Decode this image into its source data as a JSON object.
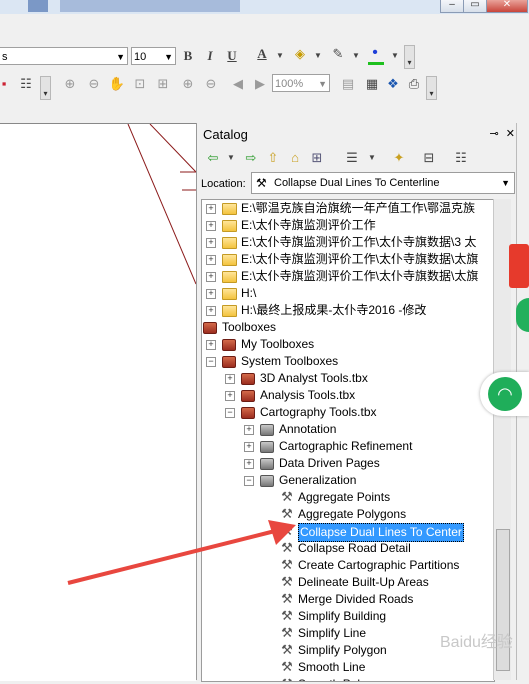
{
  "toolbar1": {
    "font_name_partial": "s",
    "font_size": "10",
    "bold": "B",
    "italic": "I",
    "underline": "U",
    "font_color_letter": "A"
  },
  "toolbar2": {
    "zoom_percent": "100%"
  },
  "catalog": {
    "title": "Catalog",
    "location_label": "Location:",
    "location_value": "Collapse Dual Lines To Centerline",
    "tree": [
      {
        "label": "E:\\鄂温克族自治旗统一年产值工作\\鄂温克族",
        "icon": "folder",
        "indent": 0,
        "expander": "+"
      },
      {
        "label": "E:\\太仆寺旗监测评价工作",
        "icon": "folder",
        "indent": 0,
        "expander": "+"
      },
      {
        "label": "E:\\太仆寺旗监测评价工作\\太仆寺旗数据\\3 太",
        "icon": "folder",
        "indent": 0,
        "expander": "+"
      },
      {
        "label": "E:\\太仆寺旗监测评价工作\\太仆寺旗数据\\太旗",
        "icon": "folder",
        "indent": 0,
        "expander": "+"
      },
      {
        "label": "E:\\太仆寺旗监测评价工作\\太仆寺旗数据\\太旗",
        "icon": "folder",
        "indent": 0,
        "expander": "+"
      },
      {
        "label": "H:\\",
        "icon": "folder",
        "indent": 0,
        "expander": "+"
      },
      {
        "label": "H:\\最终上报成果-太仆寺2016 -修改",
        "icon": "folder",
        "indent": 0,
        "expander": "+"
      },
      {
        "label": "Toolboxes",
        "icon": "toolbox",
        "indent": -1,
        "expander": "−"
      },
      {
        "label": "My Toolboxes",
        "icon": "toolbox",
        "indent": 0,
        "expander": "+"
      },
      {
        "label": "System Toolboxes",
        "icon": "toolbox",
        "indent": 0,
        "expander": "−"
      },
      {
        "label": "3D Analyst Tools.tbx",
        "icon": "toolbox",
        "indent": 1,
        "expander": "+"
      },
      {
        "label": "Analysis Tools.tbx",
        "icon": "toolbox",
        "indent": 1,
        "expander": "+"
      },
      {
        "label": "Cartography Tools.tbx",
        "icon": "toolbox",
        "indent": 1,
        "expander": "−"
      },
      {
        "label": "Annotation",
        "icon": "toolset",
        "indent": 2,
        "expander": "+"
      },
      {
        "label": "Cartographic Refinement",
        "icon": "toolset",
        "indent": 2,
        "expander": "+"
      },
      {
        "label": "Data Driven Pages",
        "icon": "toolset",
        "indent": 2,
        "expander": "+"
      },
      {
        "label": "Generalization",
        "icon": "toolset",
        "indent": 2,
        "expander": "−"
      },
      {
        "label": "Aggregate Points",
        "icon": "tool",
        "indent": 3,
        "expander": ""
      },
      {
        "label": "Aggregate Polygons",
        "icon": "tool",
        "indent": 3,
        "expander": ""
      },
      {
        "label": "Collapse Dual Lines To Center",
        "icon": "tool",
        "indent": 3,
        "expander": "",
        "selected": true
      },
      {
        "label": "Collapse Road Detail",
        "icon": "tool",
        "indent": 3,
        "expander": ""
      },
      {
        "label": "Create Cartographic Partitions",
        "icon": "tool",
        "indent": 3,
        "expander": ""
      },
      {
        "label": "Delineate Built-Up Areas",
        "icon": "tool",
        "indent": 3,
        "expander": ""
      },
      {
        "label": "Merge Divided Roads",
        "icon": "tool",
        "indent": 3,
        "expander": ""
      },
      {
        "label": "Simplify Building",
        "icon": "tool",
        "indent": 3,
        "expander": ""
      },
      {
        "label": "Simplify Line",
        "icon": "tool",
        "indent": 3,
        "expander": ""
      },
      {
        "label": "Simplify Polygon",
        "icon": "tool",
        "indent": 3,
        "expander": ""
      },
      {
        "label": "Smooth Line",
        "icon": "tool",
        "indent": 3,
        "expander": ""
      },
      {
        "label": "Smooth Polygon",
        "icon": "tool",
        "indent": 3,
        "expander": ""
      }
    ]
  },
  "watermark": "Baidu经验",
  "colors": {
    "arrow": "#e8473f",
    "selection": "#3399ff",
    "folder": "#f3c33e",
    "map_line": "#8b1a1a"
  }
}
